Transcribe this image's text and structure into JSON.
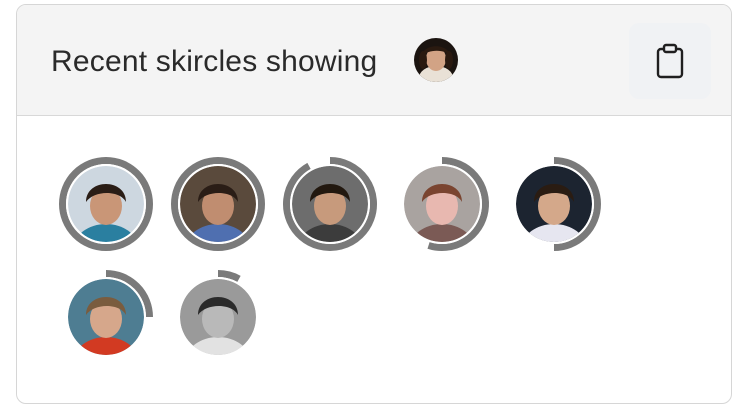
{
  "header": {
    "title": "Recent skircles showing",
    "copy_icon": "clipboard-icon"
  },
  "colors": {
    "ring": "#7a7a7a",
    "ring_gap": "#ffffff"
  },
  "avatars": [
    {
      "name": "avatar-1",
      "progress": 1.0,
      "bg": "#cdd7e0",
      "skin": "#c99677",
      "hair": "#2a1d16",
      "top": "#2a7fa0"
    },
    {
      "name": "avatar-2",
      "progress": 1.0,
      "bg": "#5a4a3c",
      "skin": "#c08d70",
      "hair": "#2a1d16",
      "top": "#4f6fb0"
    },
    {
      "name": "avatar-3",
      "progress": 0.92,
      "bg": "#6d6d6d",
      "skin": "#c79a7c",
      "hair": "#22180f",
      "top": "#3c3c3c"
    },
    {
      "name": "avatar-4",
      "progress": 0.55,
      "bg": "#a9a3a0",
      "skin": "#e8b8b0",
      "hair": "#7a4430",
      "top": "#7b5a55"
    },
    {
      "name": "avatar-5",
      "progress": 0.5,
      "bg": "#1c2430",
      "skin": "#d4a88a",
      "hair": "#2a1c12",
      "top": "#e6e6f0"
    },
    {
      "name": "avatar-6",
      "progress": 0.25,
      "bg": "#4e7d92",
      "skin": "#d6a78b",
      "hair": "#7a5c3e",
      "top": "#d23a22"
    },
    {
      "name": "avatar-7",
      "progress": 0.08,
      "bg": "#9a9a9a",
      "skin": "#b9b9b9",
      "hair": "#2a2a2a",
      "top": "#e2e2e2"
    }
  ]
}
